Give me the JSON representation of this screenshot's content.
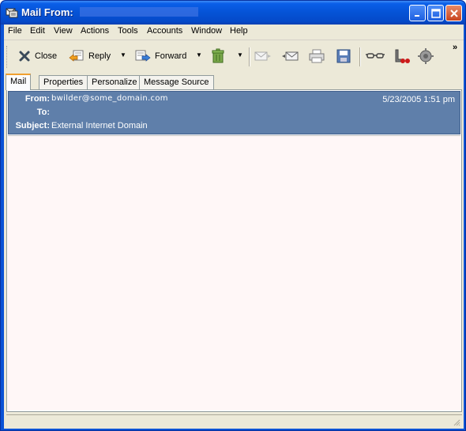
{
  "window": {
    "title": "Mail From:",
    "minimize_icon": "minimize-icon",
    "maximize_icon": "maximize-icon",
    "close_icon": "close-icon"
  },
  "menubar": {
    "items": [
      "File",
      "Edit",
      "View",
      "Actions",
      "Tools",
      "Accounts",
      "Window",
      "Help"
    ]
  },
  "toolbar": {
    "close_label": "Close",
    "reply_label": "Reply",
    "forward_label": "Forward",
    "overflow": "»",
    "icons": [
      "close-x-icon",
      "reply-icon",
      "forward-icon",
      "delete-trash-icon",
      "open-envelope-icon",
      "previous-envelope-icon",
      "print-icon",
      "save-icon",
      "glasses-icon",
      "phone-icon",
      "gear-icon"
    ]
  },
  "tabs": [
    "Mail",
    "Properties",
    "Personalize",
    "Message Source"
  ],
  "message": {
    "from_label": "From:",
    "from_value": "bwilder@some_domain.com",
    "to_label": "To:",
    "to_value": "",
    "subject_label": "Subject:",
    "subject_value": "External Internet Domain",
    "date": "5/23/2005 1:51 pm"
  },
  "colors": {
    "header_bg": "#5f7faa",
    "body_bg": "#fff7f7",
    "titlebar": "#0553d6"
  }
}
